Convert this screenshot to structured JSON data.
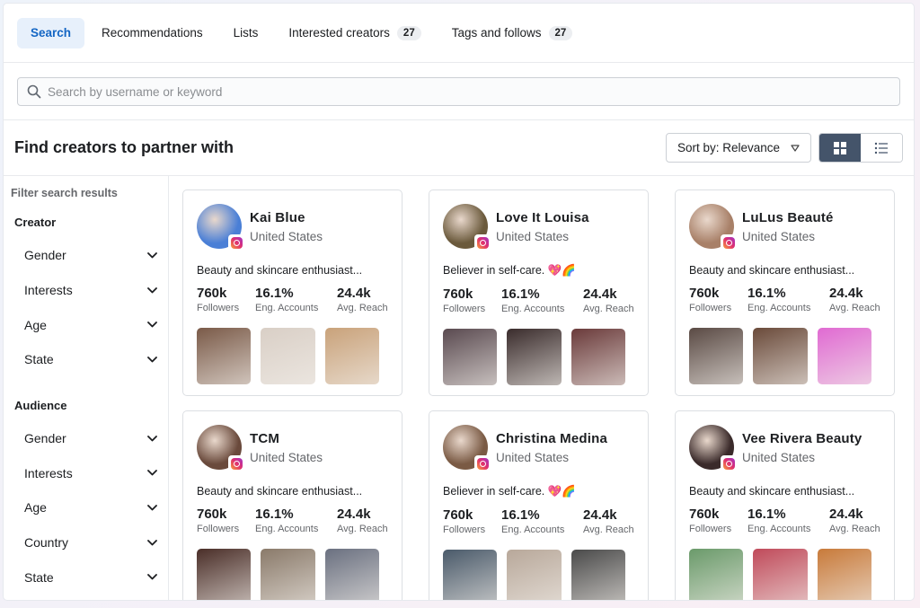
{
  "tabs": [
    {
      "label": "Search",
      "active": true
    },
    {
      "label": "Recommendations"
    },
    {
      "label": "Lists"
    },
    {
      "label": "Interested creators",
      "badge": "27"
    },
    {
      "label": "Tags and follows",
      "badge": "27"
    }
  ],
  "search": {
    "placeholder": "Search by username or keyword",
    "value": ""
  },
  "header": {
    "title": "Find creators to partner with",
    "sort_label": "Sort by: Relevance"
  },
  "filters": {
    "title": "Filter search results",
    "creator": {
      "label": "Creator",
      "items": [
        "Gender",
        "Interests",
        "Age",
        "State"
      ]
    },
    "audience": {
      "label": "Audience",
      "items": [
        "Gender",
        "Interests",
        "Age",
        "Country",
        "State"
      ]
    }
  },
  "stat_labels": {
    "followers": "Followers",
    "eng": "Eng. Accounts",
    "reach": "Avg. Reach"
  },
  "creators": [
    {
      "name": "Kai Blue",
      "country": "United States",
      "bio": "Beauty and skincare enthusiast...",
      "followers": "760k",
      "eng": "16.1%",
      "reach": "24.4k",
      "avatar_color": "#4a7fd6",
      "thumbs": [
        "#7a5a48",
        "#d9cfc6",
        "#c9a27a"
      ]
    },
    {
      "name": "Love It Louisa",
      "country": "United States",
      "bio": "Believer in self-care. 💖🌈",
      "followers": "760k",
      "eng": "16.1%",
      "reach": "24.4k",
      "avatar_color": "#6b5a3c",
      "thumbs": [
        "#5a4a50",
        "#3a2c2c",
        "#6a3a3a"
      ]
    },
    {
      "name": "LuLus Beauté",
      "country": "United States",
      "bio": "Beauty and skincare enthusiast...",
      "followers": "760k",
      "eng": "16.1%",
      "reach": "24.4k",
      "avatar_color": "#a88068",
      "thumbs": [
        "#5a4a44",
        "#6a4a3a",
        "#e06ad2"
      ]
    },
    {
      "name": "TCM",
      "country": "United States",
      "bio": "Beauty and skincare enthusiast...",
      "followers": "760k",
      "eng": "16.1%",
      "reach": "24.4k",
      "avatar_color": "#6a4a3c",
      "thumbs": [
        "#4a2e28",
        "#8a7a6a",
        "#6a7080"
      ]
    },
    {
      "name": "Christina Medina",
      "country": "United States",
      "bio": "Believer in self-care. 💖🌈",
      "followers": "760k",
      "eng": "16.1%",
      "reach": "24.4k",
      "avatar_color": "#7a5a44",
      "thumbs": [
        "#4a5a6a",
        "#b8a89a",
        "#4a4a4a"
      ]
    },
    {
      "name": "Vee Rivera Beauty",
      "country": "United States",
      "bio": "Beauty and skincare enthusiast...",
      "followers": "760k",
      "eng": "16.1%",
      "reach": "24.4k",
      "avatar_color": "#3a2a2a",
      "thumbs": [
        "#6a9a6a",
        "#c04a5a",
        "#c87a3a"
      ]
    }
  ]
}
